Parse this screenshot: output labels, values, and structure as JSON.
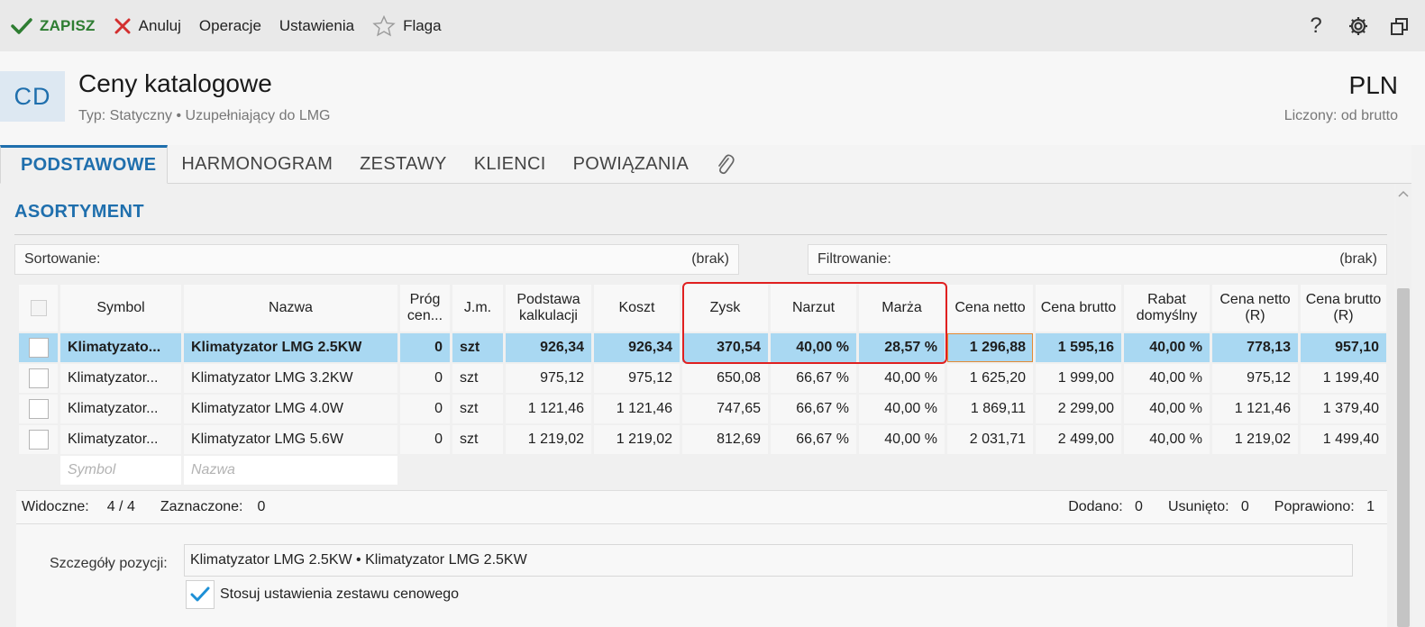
{
  "toolbar": {
    "save_label": "ZAPISZ",
    "cancel_label": "Anuluj",
    "operations_label": "Operacje",
    "settings_label": "Ustawienia",
    "flag_label": "Flaga",
    "help_label": "?"
  },
  "header": {
    "avatar": "CD",
    "title": "Ceny katalogowe",
    "subtitle": "Typ: Statyczny • Uzupełniający do LMG",
    "currency": "PLN",
    "calc": "Liczony: od brutto"
  },
  "tabs": [
    "PODSTAWOWE",
    "HARMONOGRAM",
    "ZESTAWY",
    "KLIENCI",
    "POWIĄZANIA"
  ],
  "section": {
    "title": "ASORTYMENT"
  },
  "sorting": {
    "label": "Sortowanie:",
    "value": "(brak)"
  },
  "filtering": {
    "label": "Filtrowanie:",
    "value": "(brak)"
  },
  "grid": {
    "columns": [
      "Symbol",
      "Nazwa",
      "Próg cen...",
      "J.m.",
      "Podstawa kalkulacji",
      "Koszt",
      "Zysk",
      "Narzut",
      "Marża",
      "Cena netto",
      "Cena brutto",
      "Rabat domyślny",
      "Cena netto (R)",
      "Cena brutto (R)"
    ],
    "rows": [
      [
        "Klimatyzato...",
        "Klimatyzator LMG 2.5KW",
        "0",
        "szt",
        "926,34",
        "926,34",
        "370,54",
        "40,00 %",
        "28,57 %",
        "1 296,88",
        "1 595,16",
        "40,00 %",
        "778,13",
        "957,10"
      ],
      [
        "Klimatyzator...",
        "Klimatyzator LMG 3.2KW",
        "0",
        "szt",
        "975,12",
        "975,12",
        "650,08",
        "66,67 %",
        "40,00 %",
        "1 625,20",
        "1 999,00",
        "40,00 %",
        "975,12",
        "1 199,40"
      ],
      [
        "Klimatyzator...",
        "Klimatyzator LMG 4.0W",
        "0",
        "szt",
        "1 121,46",
        "1 121,46",
        "747,65",
        "66,67 %",
        "40,00 %",
        "1 869,11",
        "2 299,00",
        "40,00 %",
        "1 121,46",
        "1 379,40"
      ],
      [
        "Klimatyzator...",
        "Klimatyzator LMG 5.6W",
        "0",
        "szt",
        "1 219,02",
        "1 219,02",
        "812,69",
        "66,67 %",
        "40,00 %",
        "2 031,71",
        "2 499,00",
        "40,00 %",
        "1 219,02",
        "1 499,40"
      ]
    ],
    "new_row": {
      "symbol_placeholder": "Symbol",
      "name_placeholder": "Nazwa"
    }
  },
  "status": {
    "visible_label": "Widoczne:",
    "visible_value": "4 /  4",
    "selected_label": "Zaznaczone:",
    "selected_value": "0",
    "added_label": "Dodano:",
    "added_value": "0",
    "removed_label": "Usunięto:",
    "removed_value": "0",
    "fixed_label": "Poprawiono:",
    "fixed_value": "1"
  },
  "details": {
    "label": "Szczegóły pozycji:",
    "value": "Klimatyzator LMG 2.5KW   •   Klimatyzator LMG 2.5KW",
    "checkbox_label": "Stosuj ustawienia zestawu cenowego",
    "checkbox_checked": true
  },
  "colors": {
    "accent": "#1f6fad",
    "selected_row": "#a9d8f2",
    "save": "#2e7d32",
    "cancel": "#d32f2f",
    "highlight_box": "#e02020"
  }
}
